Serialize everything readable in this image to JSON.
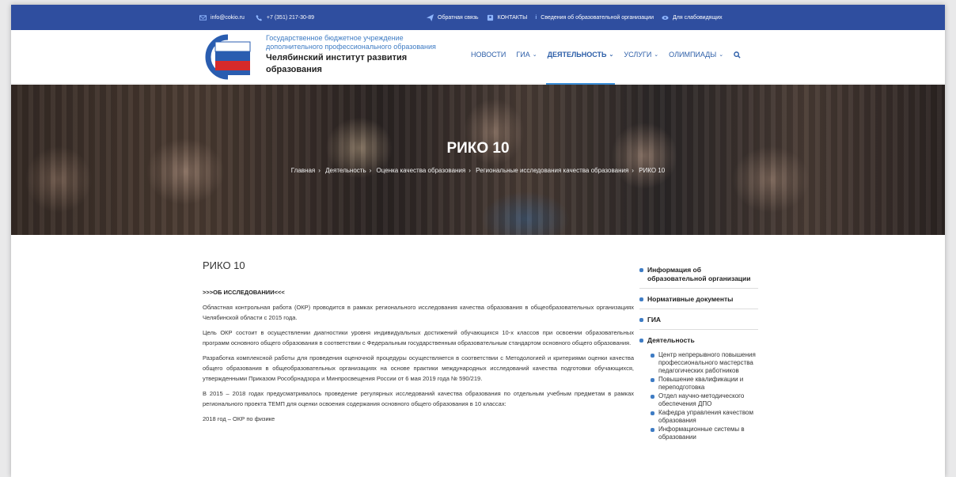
{
  "topbar": {
    "email": "info@cokio.ru",
    "phone": "+7 (351) 217-30-89",
    "feedback": "Обратная связь",
    "contacts": "КОНТАКТЫ",
    "org_info": "Сведения об образовательной организации",
    "accessible": "Для слабовидящих"
  },
  "header": {
    "org_line1": "Государственное бюджетное учреждение",
    "org_line2": "дополнительного профессионального образования",
    "org_name1": "Челябинский институт развития",
    "org_name2": "образования"
  },
  "nav": [
    {
      "label": "НОВОСТИ",
      "dropdown": false
    },
    {
      "label": "ГИА",
      "dropdown": true
    },
    {
      "label": "ДЕЯТЕЛЬНОСТЬ",
      "dropdown": true,
      "active": true
    },
    {
      "label": "УСЛУГИ",
      "dropdown": true
    },
    {
      "label": "ОЛИМПИАДЫ",
      "dropdown": true
    }
  ],
  "hero": {
    "title": "РИКО 10",
    "breadcrumbs": [
      "Главная",
      "Деятельность",
      "Оценка качества образования",
      "Региональные исследования качества образования",
      "РИКО 10"
    ]
  },
  "main": {
    "title": "РИКО 10",
    "about": ">>>ОБ ИССЛЕДОВАНИИ<<<",
    "paragraphs": [
      "Областная контрольная работа (ОКР) проводится в рамках регионального исследования качества образования в общеобразовательных организациях Челябинской области с 2015 года.",
      "Цель ОКР состоит в осуществлении диагностики уровня индивидуальных достижений обучающихся 10-х классов при освоении образовательных программ основного общего образования в соответствии с Федеральным государственным образовательным стандартом основного общего образования.",
      "Разработка комплексной работы для проведения оценочной процедуры осуществляется в соответствии с Методологией и критериями оценки качества общего образования в общеобразовательных организациях на основе практики международных исследований качества подготовки обучающихся, утвержденными Приказом Рособрнадзора и Минпросвещения России от 6 мая 2019 года № 590/219.",
      "В 2015 – 2018 годах предусматривалось проведение регулярных исследований качества образования по отдельным учебным предметам в рамках регионального проекта ТЕМП для оценки освоения содержания основного общего образования в 10 классах:",
      "2018 год – ОКР по физике"
    ]
  },
  "sidebar": {
    "items": [
      "Информация об образовательной организации",
      "Нормативные документы",
      "ГИА",
      "Деятельность"
    ],
    "sub_items": [
      "Центр непрерывного повышения профессионального мастерства педагогических работников",
      "Повышение квалификации и переподготовка",
      "Отдел научно-методического обеспечения ДПО",
      "Кафедра управления качеством образования",
      "Информационные системы в образовании"
    ]
  }
}
